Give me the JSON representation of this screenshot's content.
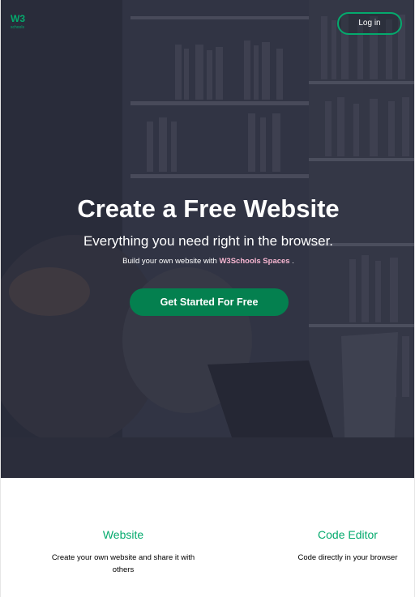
{
  "brand": {
    "logo_text": "W3",
    "logo_sub": "schools",
    "accent_color": "#04aa6d",
    "cta_color": "#04804f"
  },
  "header": {
    "login_label": "Log in"
  },
  "hero": {
    "title": "Create a Free Website",
    "subtitle": "Everything you need right in the browser.",
    "tagline_prefix": "Build your own website with",
    "tagline_highlight": "W3Schools Spaces",
    "tagline_suffix": ".",
    "cta_label": "Get Started For Free"
  },
  "features": [
    {
      "title": "Website",
      "description": "Create your own website and share it with others"
    },
    {
      "title": "Code Editor",
      "description": "Code directly in your browser"
    }
  ]
}
